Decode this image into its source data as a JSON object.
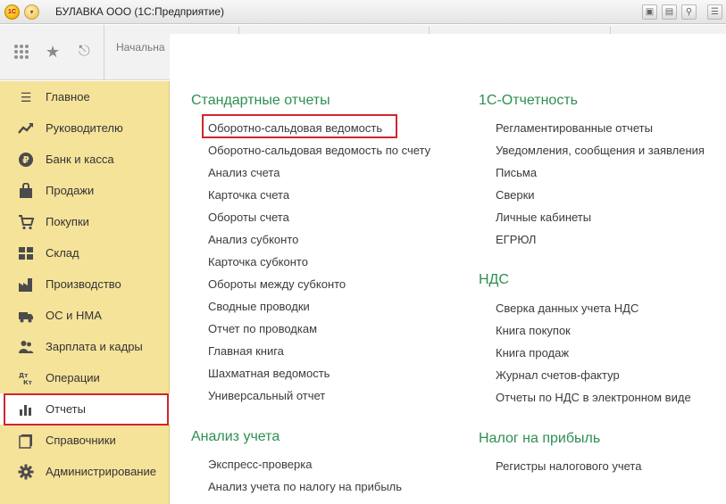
{
  "window": {
    "title": "БУЛАВКА ООО  (1С:Предприятие)",
    "logo_text": "1С"
  },
  "topbar": {
    "home_tab": "Начальна"
  },
  "sidebar": {
    "items": [
      {
        "label": "Главное",
        "icon": "menu-lines-icon"
      },
      {
        "label": "Руководителю",
        "icon": "trend-icon"
      },
      {
        "label": "Банк и касса",
        "icon": "ruble-coin-icon"
      },
      {
        "label": "Продажи",
        "icon": "shopping-bag-icon"
      },
      {
        "label": "Покупки",
        "icon": "cart-icon"
      },
      {
        "label": "Склад",
        "icon": "warehouse-grid-icon"
      },
      {
        "label": "Производство",
        "icon": "factory-icon"
      },
      {
        "label": "ОС и НМА",
        "icon": "truck-icon"
      },
      {
        "label": "Зарплата и кадры",
        "icon": "people-icon"
      },
      {
        "label": "Операции",
        "icon": "dt-kt-icon"
      },
      {
        "label": "Отчеты",
        "icon": "bar-chart-icon"
      },
      {
        "label": "Справочники",
        "icon": "books-icon"
      },
      {
        "label": "Администрирование",
        "icon": "gear-icon"
      }
    ],
    "active": "Отчеты"
  },
  "panel": {
    "standard_reports": {
      "title": "Стандартные отчеты",
      "links": [
        "Оборотно-сальдовая ведомость",
        "Оборотно-сальдовая ведомость по счету",
        "Анализ счета",
        "Карточка счета",
        "Обороты счета",
        "Анализ субконто",
        "Карточка субконто",
        "Обороты между субконто",
        "Сводные проводки",
        "Отчет по проводкам",
        "Главная книга",
        "Шахматная ведомость",
        "Универсальный отчет"
      ]
    },
    "accounting_analysis": {
      "title": "Анализ учета",
      "links": [
        "Экспресс-проверка",
        "Анализ учета по налогу на прибыль"
      ]
    },
    "reporting_1c": {
      "title": "1С-Отчетность",
      "links": [
        "Регламентированные отчеты",
        "Уведомления, сообщения и заявления",
        "Письма",
        "Сверки",
        "Личные кабинеты",
        "ЕГРЮЛ"
      ]
    },
    "vat": {
      "title": "НДС",
      "links": [
        "Сверка данных учета НДС",
        "Книга покупок",
        "Книга продаж",
        "Журнал счетов-фактур",
        "Отчеты по НДС в электронном виде"
      ]
    },
    "profit_tax": {
      "title": "Налог на прибыль",
      "links": [
        "Регистры налогового учета"
      ]
    }
  },
  "colors": {
    "sidebar_bg": "#f6e39a",
    "section_title": "#2e8f51",
    "highlight": "#d0262d"
  }
}
